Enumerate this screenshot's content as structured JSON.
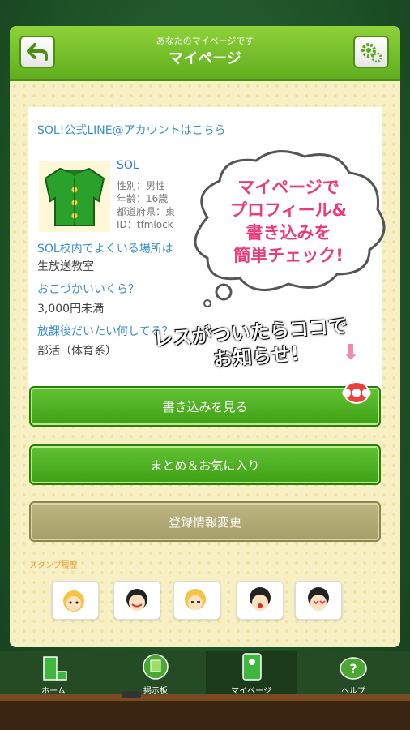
{
  "header": {
    "subtitle": "あなたのマイページです",
    "title": "マイページ"
  },
  "line_link": "SOL!公式LINE@アカウントはこちら",
  "profile": {
    "name": "SOL",
    "gender": "性別：男性",
    "age": "年齢：16歳",
    "prefecture": "都道府県：東",
    "id": "ID：tfmlock"
  },
  "qa": [
    {
      "q": "SOL校内でよくいる場所は",
      "a": "生放送教室"
    },
    {
      "q": "おこづかいいくら？",
      "a": "3,000円未満"
    },
    {
      "q": "放課後だいたい何してる？",
      "a": "部活（体育系）"
    }
  ],
  "promo": {
    "cloud_lines": [
      "マイページで",
      "プロフィール&",
      "書き込みを",
      "簡単チェック!"
    ],
    "callout_lines": [
      "レスがついたらココで",
      "お知らせ!"
    ]
  },
  "buttons": {
    "view_posts": "書き込みを見る",
    "favorites": "まとめ＆お気に入り",
    "edit_profile": "登録情報変更"
  },
  "stamps_label": "スタンプ履歴",
  "tabs": [
    {
      "label": "ホーム",
      "icon": "home-icon"
    },
    {
      "label": "掲示板",
      "icon": "board-icon"
    },
    {
      "label": "マイページ",
      "icon": "mypage-icon"
    },
    {
      "label": "ヘルプ",
      "icon": "help-icon"
    }
  ],
  "colors": {
    "header_green": "#6cc02a",
    "button_green": "#4cae1e",
    "button_olive": "#b0a970",
    "link_blue": "#3a8fd0",
    "notify_red": "#ee3f3f"
  }
}
